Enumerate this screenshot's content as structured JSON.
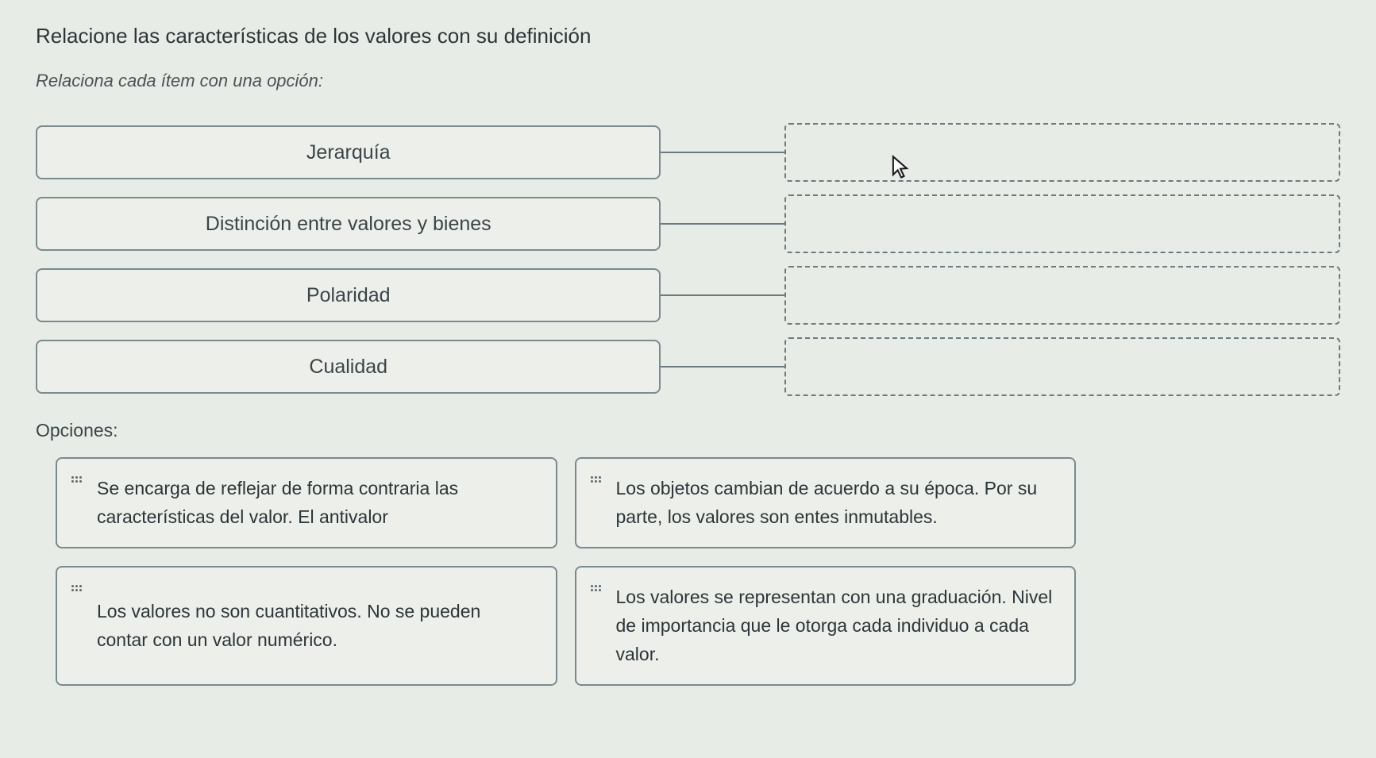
{
  "question": {
    "title": "Relacione las características de los valores con su definición",
    "instruction": "Relaciona cada ítem con una opción:"
  },
  "items": [
    {
      "label": "Jerarquía"
    },
    {
      "label": "Distinción entre valores y bienes"
    },
    {
      "label": "Polaridad"
    },
    {
      "label": "Cualidad"
    }
  ],
  "optionsLabel": "Opciones:",
  "options": [
    {
      "text": "Se encarga de reflejar de forma contraria las características del valor. El antivalor"
    },
    {
      "text": "Los objetos cambian de acuerdo a su época. Por su parte, los valores son entes inmutables."
    },
    {
      "text": "Los valores no son cuantitativos. No se pueden contar con un valor numérico."
    },
    {
      "text": "Los valores se representan con una graduación. Nivel de importancia que le otorga cada individuo a cada valor."
    }
  ]
}
